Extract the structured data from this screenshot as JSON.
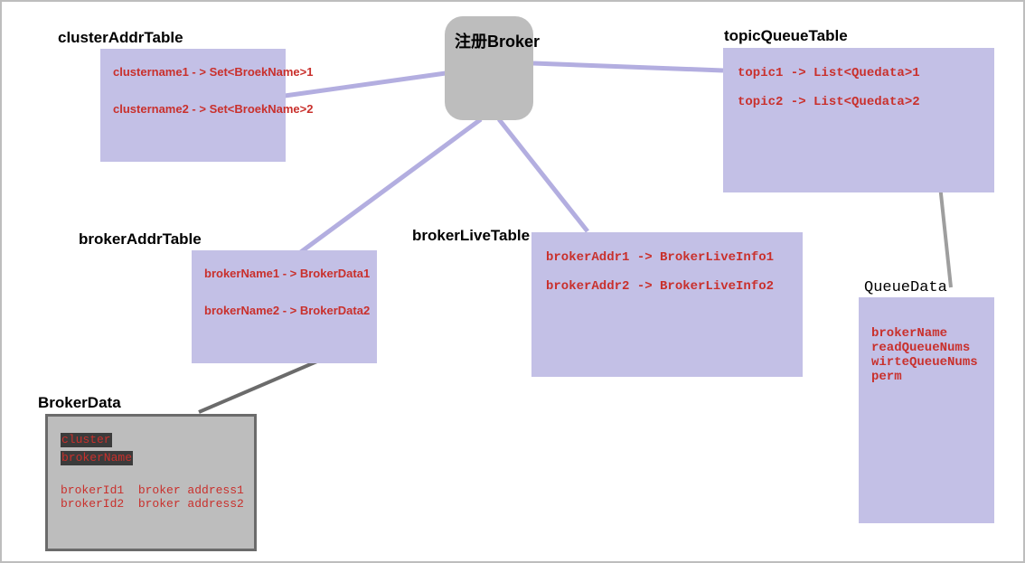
{
  "central": {
    "label": "注册Broker"
  },
  "clusterAddrTable": {
    "title": "clusterAddrTable",
    "rows": [
      "clustername1 - > Set<BroekName>1",
      "clustername2 - > Set<BroekName>2"
    ]
  },
  "brokerAddrTable": {
    "title": "brokerAddrTable",
    "rows": [
      "brokerName1 - > BrokerData1",
      "brokerName2 - > BrokerData2"
    ]
  },
  "brokerLiveTable": {
    "title": "brokerLiveTable",
    "rows": [
      "brokerAddr1 -> BrokerLiveInfo1",
      "brokerAddr2 -> BrokerLiveInfo2"
    ]
  },
  "topicQueueTable": {
    "title": "topicQueueTable",
    "rows": [
      "topic1 -> List<Quedata>1",
      "topic2 -> List<Quedata>2"
    ]
  },
  "queueData": {
    "title": "QueueData",
    "fields": [
      "brokerName",
      "readQueueNums",
      "wirteQueueNums",
      "perm"
    ]
  },
  "brokerData": {
    "title": "BrokerData",
    "chips": [
      "cluster",
      "brokerName"
    ],
    "lines": [
      "brokerId1  broker address1",
      "brokerId2  broker address2"
    ]
  }
}
